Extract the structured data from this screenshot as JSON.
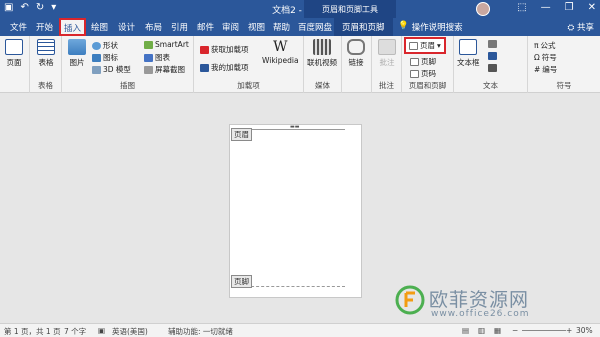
{
  "titlebar": {
    "doc_title": "文档2 - Word",
    "context_tools": "页眉和页脚工具",
    "minimize": "—",
    "restore": "❐",
    "close": "✕"
  },
  "tabs": {
    "items": [
      "文件",
      "开始",
      "插入",
      "绘图",
      "设计",
      "布局",
      "引用",
      "邮件",
      "审阅",
      "视图",
      "帮助",
      "百度网盘"
    ],
    "context_tab": "页眉和页脚",
    "search": "操作说明搜索",
    "share": "共享"
  },
  "ribbon": {
    "pages": {
      "label": "页面"
    },
    "tables": {
      "button": "表格",
      "group": "表格"
    },
    "illustrations": {
      "picture": "图片",
      "shapes": "形状",
      "icons": "图标",
      "model3d": "3D 模型",
      "smartart": "SmartArt",
      "chart": "图表",
      "screenshot": "屏幕截图",
      "group": "插图"
    },
    "addins": {
      "get": "获取加载项",
      "my": "我的加载项",
      "wikipedia": "Wikipedia",
      "group": "加载项"
    },
    "media": {
      "online_video": "联机视频",
      "group": "媒体"
    },
    "links": {
      "link": "链接"
    },
    "comments": {
      "comment": "批注",
      "group": "批注"
    },
    "header_footer": {
      "header": "页眉",
      "footer": "页脚",
      "page_number": "页码",
      "group": "页眉和页脚"
    },
    "text": {
      "textbox": "文本框",
      "group": "文本"
    },
    "symbols": {
      "equation": "公式",
      "symbol": "符号",
      "number": "编号",
      "group": "符号"
    }
  },
  "document": {
    "header_tag": "页眉",
    "footer_tag": "页脚"
  },
  "status": {
    "page": "第 1 页，共 1 页",
    "words": "7 个字",
    "language": "英语(美国)",
    "accessibility": "辅助功能: 一切就绪",
    "zoom": "30%"
  },
  "watermark": {
    "title": "欧菲资源网",
    "url": "www.office26.com"
  }
}
